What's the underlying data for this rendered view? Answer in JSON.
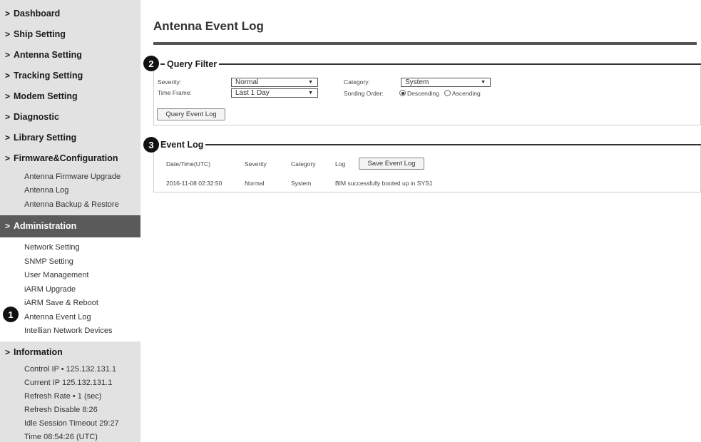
{
  "sidebar": {
    "nav": [
      "Dashboard",
      "Ship Setting",
      "Antenna Setting",
      "Tracking Setting",
      "Modem Setting",
      "Diagnostic",
      "Library Setting",
      "Firmware&Configuration"
    ],
    "firmware_sub": [
      "Antenna Firmware Upgrade",
      "Antenna Log",
      "Antenna Backup & Restore"
    ],
    "admin_label": "Administration",
    "admin_sub": [
      "Network Setting",
      "SNMP Setting",
      "User Management",
      "iARM Upgrade",
      "iARM Save & Reboot",
      "Antenna Event Log",
      "Intellian Network Devices"
    ],
    "info_label": "Information",
    "info_rows": [
      "Control IP • 125.132.131.1",
      "Current IP  125.132.131.1",
      "Refresh Rate •   1 (sec)",
      "Refresh Disable  8:26",
      "Idle Session Timeout  29:27",
      "Time  08:54:26 (UTC)"
    ]
  },
  "markers": [
    "1",
    "2",
    "3"
  ],
  "main": {
    "title": "Antenna Event Log",
    "query_filter": {
      "heading": "Query Filter",
      "severity_label": "Severity:",
      "severity_value": "Normal",
      "timeframe_label": "Time Frame:",
      "timeframe_value": "Last 1 Day",
      "category_label": "Category:",
      "category_value": "System",
      "sort_label": "Sording Order:",
      "sort_desc": "Descending",
      "sort_asc": "Ascending",
      "query_button": "Query Event Log"
    },
    "event_log": {
      "heading": "Event Log",
      "columns": [
        "Date/Time(UTC)",
        "Severity",
        "Category",
        "Log"
      ],
      "save_button": "Save Event Log",
      "rows": [
        [
          "2016-11-08 02:32:50",
          "Normal",
          "System",
          "BIM successfully booted up in SYS1"
        ]
      ]
    }
  }
}
